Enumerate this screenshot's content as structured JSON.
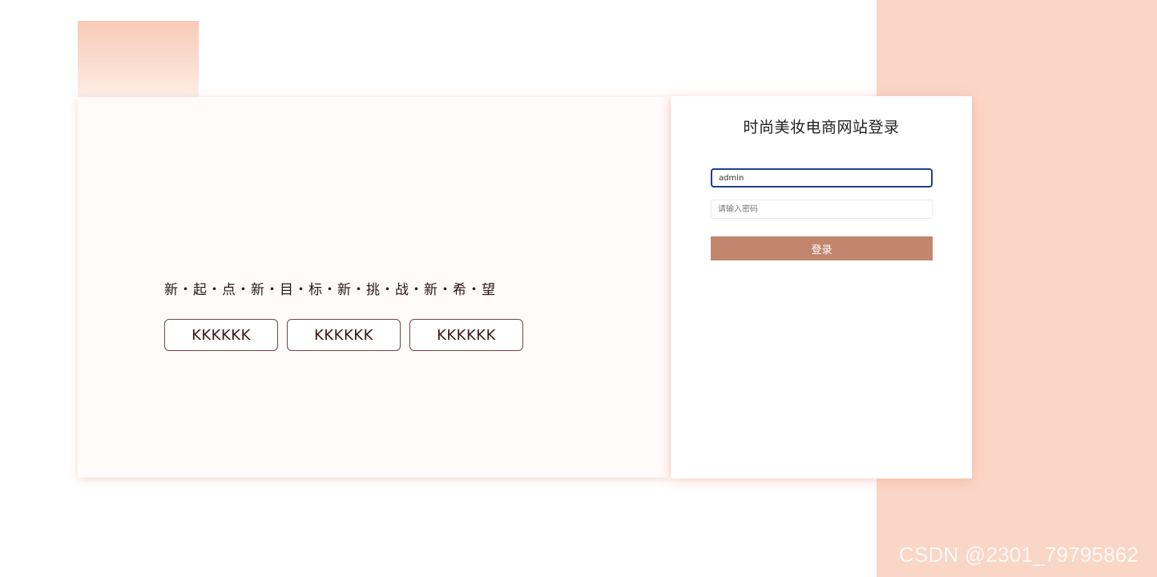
{
  "hero": {
    "slogan": "新・起・点・新・目・标・新・挑・战・新・希・望",
    "buttons": [
      "KKKKKK",
      "KKKKKK",
      "KKKKKK"
    ]
  },
  "login": {
    "title": "时尚美妆电商网站登录",
    "username_value": "admin",
    "password_placeholder": "请输入密码",
    "submit_label": "登录"
  },
  "watermark": "CSDN @2301_79795862",
  "colors": {
    "accent_background": "#fad6c7",
    "login_button": "#c2856e",
    "focus_border": "#1f3f8f"
  }
}
